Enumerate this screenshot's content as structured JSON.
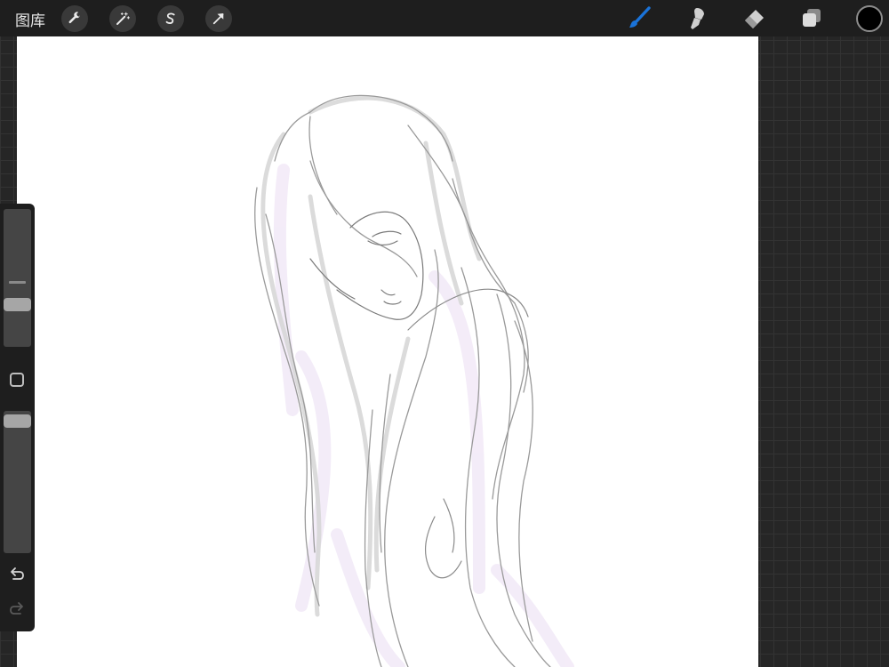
{
  "topbar": {
    "gallery_label": "图库",
    "left_tools": [
      "wrench-icon",
      "magic-wand-icon",
      "selection-icon",
      "transform-arrow-icon"
    ],
    "right_tools": [
      "brush-icon",
      "smudge-icon",
      "eraser-icon",
      "layers-icon"
    ],
    "active_tool": "brush",
    "accent_color": "#1a73d9",
    "current_color": "#000000"
  },
  "sidebar": {
    "controls": [
      "brush-size-slider",
      "modify-button",
      "opacity-slider",
      "undo-icon",
      "redo-icon"
    ]
  },
  "canvas": {
    "background": "#ffffff",
    "content": "pencil sketch"
  }
}
